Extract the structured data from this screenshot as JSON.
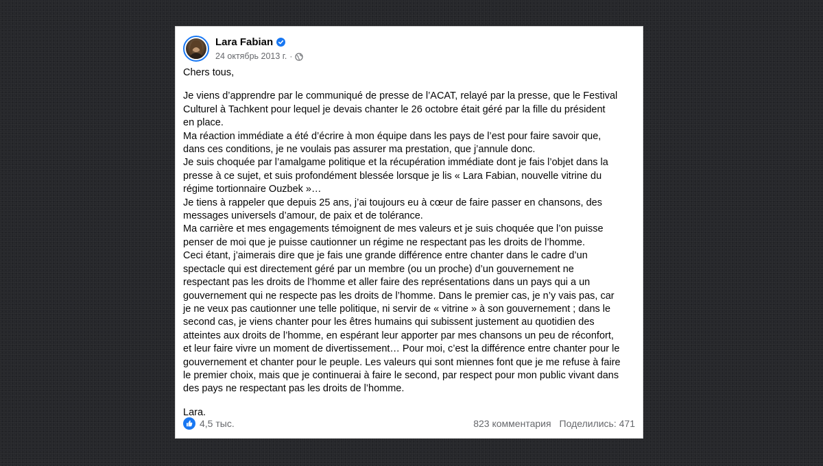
{
  "post": {
    "author": "Lara Fabian",
    "verified_icon": "verified-badge-icon",
    "date": "24 октябрь 2013 г.",
    "separator": "·",
    "audience_icon": "globe-icon",
    "greeting": "Chers tous,",
    "paragraph_lines": [
      "Je viens d’apprendre par le communiqué de presse de l’ACAT, relayé par la presse, que le Festival",
      "Culturel à Tachkent pour lequel je devais chanter le 26 octobre était géré par la fille du président",
      "en place.",
      "Ma réaction immédiate a été d’écrire à mon équipe dans les pays de l’est pour faire savoir que,",
      "dans ces conditions, je ne voulais pas assurer ma prestation, que j’annule donc.",
      "Je suis choquée par l’amalgame politique et la récupération immédiate dont je fais l’objet dans la",
      "presse à ce sujet, et suis profondément blessée lorsque je lis « Lara Fabian, nouvelle vitrine du",
      "régime tortionnaire Ouzbek »…",
      "Je tiens à rappeler que depuis 25 ans, j’ai toujours eu à cœur de faire passer en chansons, des",
      "messages universels d’amour, de paix et de tolérance.",
      "Ma carrière et mes engagements témoignent de mes valeurs et je suis choquée que l’on puisse",
      "penser de moi que je puisse cautionner un régime ne respectant pas les droits de l’homme.",
      "Ceci étant, j’aimerais dire que je fais une grande différence entre chanter dans le cadre d’un",
      "spectacle qui est directement géré par un membre (ou un proche) d’un gouvernement ne",
      "respectant pas les droits de l’homme et aller faire des représentations dans un pays qui a un",
      "gouvernement qui ne respecte pas les droits de l’homme. Dans le premier cas, je n’y vais pas, car",
      "je ne veux pas cautionner une telle politique, ni servir de « vitrine » à son gouvernement ; dans le",
      "second cas, je viens chanter pour les êtres humains qui subissent justement au quotidien des",
      "atteintes aux droits de l’homme, en espérant leur apporter par mes chansons un peu de réconfort,",
      "et leur faire vivre un moment de divertissement… Pour moi, c’est la différence entre chanter pour le",
      "gouvernement et chanter pour le peuple. Les valeurs qui sont miennes font que je me refuse à faire",
      "le premier choix, mais que je continuerai à faire le second, par respect pour mon public vivant dans",
      "des pays ne respectant pas les droits de l’homme."
    ],
    "signoff": "Lara."
  },
  "footer": {
    "reaction_icon": "like-icon",
    "reaction_count": "4,5 тыс.",
    "comments": "823 комментария",
    "shares": "Поделились: 471"
  },
  "colors": {
    "background": "#26272b",
    "card": "#ffffff",
    "accent_blue": "#1877f2",
    "text_primary": "#050505",
    "text_secondary": "#65676b"
  }
}
